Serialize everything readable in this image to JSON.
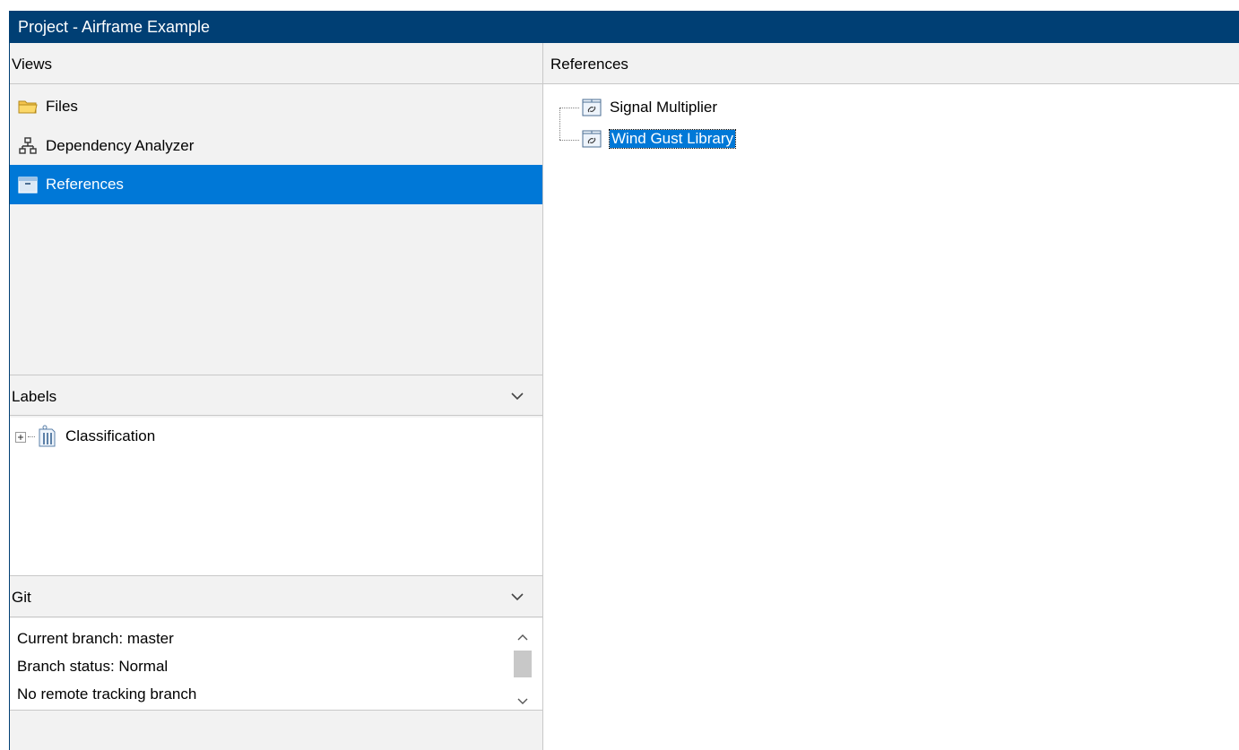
{
  "window": {
    "title": "Project - Airframe Example"
  },
  "views": {
    "header": "Views",
    "items": [
      {
        "label": "Files",
        "icon": "folder-icon"
      },
      {
        "label": "Dependency Analyzer",
        "icon": "dependency-tree-icon"
      },
      {
        "label": "References",
        "icon": "references-icon",
        "selected": true
      }
    ]
  },
  "labels": {
    "header": "Labels",
    "items": [
      {
        "label": "Classification",
        "icon": "label-tag-icon",
        "expander": "plus"
      }
    ]
  },
  "git": {
    "header": "Git",
    "lines": [
      "Current branch: master",
      "Branch status: Normal",
      "No remote tracking branch"
    ]
  },
  "references": {
    "header": "References",
    "items": [
      {
        "label": "Signal Multiplier",
        "icon": "project-reference-icon"
      },
      {
        "label": "Wind Gust Library",
        "icon": "project-reference-icon",
        "selected": true
      }
    ]
  },
  "colors": {
    "titlebar": "#003f74",
    "selection": "#0078d7",
    "panel": "#f2f2f2"
  }
}
